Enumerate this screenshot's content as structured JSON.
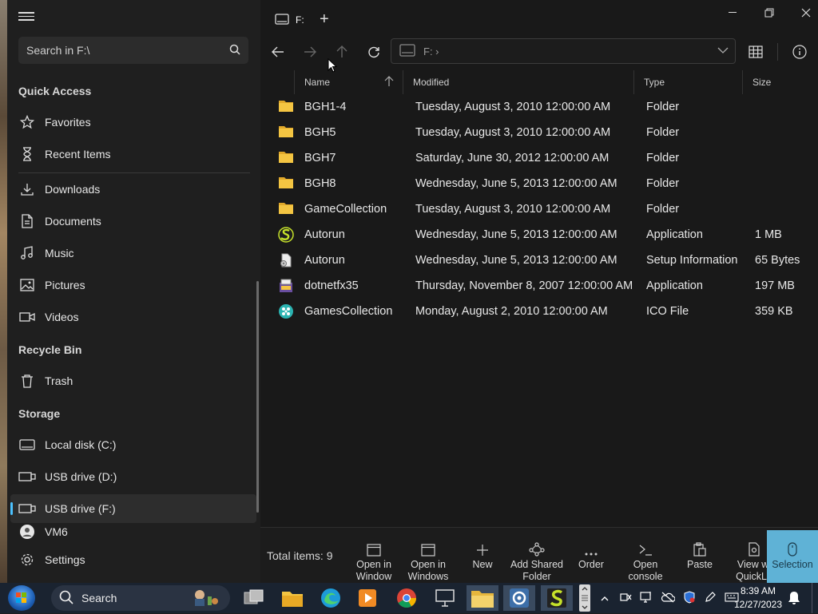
{
  "sidebar": {
    "search_placeholder": "Search in F:\\",
    "sections": {
      "quick_access": "Quick Access",
      "recycle_bin": "Recycle Bin",
      "storage": "Storage"
    },
    "items": {
      "favorites": "Favorites",
      "recent": "Recent Items",
      "downloads": "Downloads",
      "documents": "Documents",
      "music": "Music",
      "pictures": "Pictures",
      "videos": "Videos",
      "trash": "Trash",
      "local_c": "Local disk (C:)",
      "usb_d": "USB drive (D:)",
      "usb_f": "USB drive (F:)",
      "vm6": "VM6",
      "settings": "Settings"
    }
  },
  "tab": {
    "label": "F:"
  },
  "address": {
    "path": "F:  ›"
  },
  "columns": {
    "name": "Name",
    "modified": "Modified",
    "type": "Type",
    "size": "Size"
  },
  "files": [
    {
      "name": "BGH1-4",
      "modified": "Tuesday, August 3, 2010 12:00:00 AM",
      "type": "Folder",
      "size": "",
      "icon": "folder-icon"
    },
    {
      "name": "BGH5",
      "modified": "Tuesday, August 3, 2010 12:00:00 AM",
      "type": "Folder",
      "size": "",
      "icon": "folder-icon"
    },
    {
      "name": "BGH7",
      "modified": "Saturday, June 30, 2012 12:00:00 AM",
      "type": "Folder",
      "size": "",
      "icon": "folder-icon"
    },
    {
      "name": "BGH8",
      "modified": "Wednesday, June 5, 2013 12:00:00 AM",
      "type": "Folder",
      "size": "",
      "icon": "folder-icon"
    },
    {
      "name": "GameCollection",
      "modified": "Tuesday, August 3, 2010 12:00:00 AM",
      "type": "Folder",
      "size": "",
      "icon": "folder-icon"
    },
    {
      "name": "Autorun",
      "modified": "Wednesday, June 5, 2013 12:00:00 AM",
      "type": "Application",
      "size": "1 MB",
      "icon": "app-s-icon"
    },
    {
      "name": "Autorun",
      "modified": "Wednesday, June 5, 2013 12:00:00 AM",
      "type": "Setup Information",
      "size": "65 Bytes",
      "icon": "setup-info-icon"
    },
    {
      "name": "dotnetfx35",
      "modified": "Thursday, November 8, 2007 12:00:00 AM",
      "type": "Application",
      "size": "197 MB",
      "icon": "installer-icon"
    },
    {
      "name": "GamesCollection",
      "modified": "Monday, August 2, 2010 12:00:00 AM",
      "type": "ICO File",
      "size": "359 KB",
      "icon": "ico-file-icon"
    }
  ],
  "status": {
    "total": "Total items: 9",
    "tools": {
      "open_window": [
        "Open in",
        "Window"
      ],
      "open_windows": [
        "Open in",
        "Windows"
      ],
      "new": "New",
      "add_shared": [
        "Add Shared",
        "Folder"
      ],
      "order": "Order",
      "open_console": [
        "Open",
        "console"
      ],
      "paste": "Paste",
      "quicklook": [
        "View wi",
        "QuickLo"
      ],
      "selection": "Selection"
    }
  },
  "taskbar": {
    "search": "Search",
    "time": "8:39 AM",
    "date": "12/27/2023"
  },
  "colors": {
    "accent": "#4cc2ff",
    "folder": "#f4c542",
    "selection_btn": "#5fb2d6"
  }
}
